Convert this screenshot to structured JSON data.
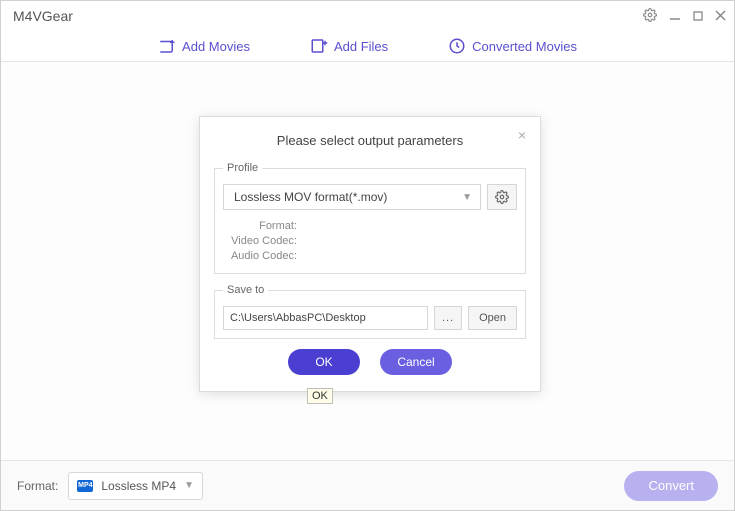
{
  "app": {
    "title": "M4VGear"
  },
  "toolbar": {
    "add_movies": "Add Movies",
    "add_files": "Add Files",
    "converted_movies": "Converted Movies"
  },
  "dialog": {
    "title": "Please select output parameters",
    "profile": {
      "legend": "Profile",
      "selected": "Lossless MOV format(*.mov)",
      "format_label": "Format:",
      "video_codec_label": "Video Codec:",
      "audio_codec_label": "Audio Codec:"
    },
    "saveto": {
      "legend": "Save to",
      "path": "C:\\Users\\AbbasPC\\Desktop",
      "browse": "...",
      "open": "Open"
    },
    "ok": "OK",
    "cancel": "Cancel",
    "tooltip": "OK"
  },
  "bottom": {
    "format_label": "Format:",
    "format_value": "Lossless MP4",
    "mp4_badge": "MP4",
    "convert": "Convert"
  }
}
